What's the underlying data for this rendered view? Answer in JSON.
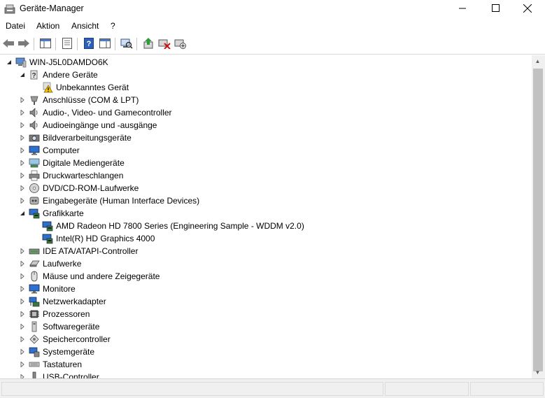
{
  "window": {
    "title": "Geräte-Manager",
    "icon": "device-manager-icon",
    "controls": {
      "minimize": "minimize-icon",
      "maximize": "maximize-icon",
      "close": "close-icon"
    }
  },
  "menu": {
    "items": [
      {
        "label": "Datei"
      },
      {
        "label": "Aktion"
      },
      {
        "label": "Ansicht"
      },
      {
        "label": "?"
      }
    ]
  },
  "toolbar": {
    "buttons": [
      {
        "name": "back-icon"
      },
      {
        "name": "forward-icon"
      },
      {
        "name": "show-hide-console-tree-icon"
      },
      {
        "name": "properties-icon"
      },
      {
        "name": "help-icon"
      },
      {
        "name": "show-action-pane-icon"
      },
      {
        "name": "scan-hardware-changes-icon"
      },
      {
        "name": "update-driver-icon"
      },
      {
        "name": "uninstall-device-icon"
      },
      {
        "name": "disable-device-icon"
      }
    ]
  },
  "tree": {
    "root": {
      "label": "WIN-J5L0DAMDO6K",
      "expanded": true,
      "icon": "computer-icon"
    },
    "categories": [
      {
        "label": "Andere Geräte",
        "expanded": true,
        "icon": "unknown-device-category-icon",
        "children": [
          {
            "label": "Unbekanntes Gerät",
            "icon": "warning-device-icon"
          }
        ]
      },
      {
        "label": "Anschlüsse (COM & LPT)",
        "expanded": false,
        "icon": "port-icon"
      },
      {
        "label": "Audio-, Video- und Gamecontroller",
        "expanded": false,
        "icon": "speaker-icon"
      },
      {
        "label": "Audioeingänge und -ausgänge",
        "expanded": false,
        "icon": "speaker-icon"
      },
      {
        "label": "Bildverarbeitungsgeräte",
        "expanded": false,
        "icon": "camera-icon"
      },
      {
        "label": "Computer",
        "expanded": false,
        "icon": "monitor-icon"
      },
      {
        "label": "Digitale Mediengeräte",
        "expanded": false,
        "icon": "media-device-icon"
      },
      {
        "label": "Druckwarteschlangen",
        "expanded": false,
        "icon": "printer-icon"
      },
      {
        "label": "DVD/CD-ROM-Laufwerke",
        "expanded": false,
        "icon": "disc-drive-icon"
      },
      {
        "label": "Eingabegeräte (Human Interface Devices)",
        "expanded": false,
        "icon": "hid-icon"
      },
      {
        "label": "Grafikkarte",
        "expanded": true,
        "icon": "display-adapter-icon",
        "children": [
          {
            "label": "AMD Radeon HD 7800 Series (Engineering Sample - WDDM v2.0)",
            "icon": "display-adapter-icon"
          },
          {
            "label": "Intel(R) HD Graphics 4000",
            "icon": "display-adapter-icon"
          }
        ]
      },
      {
        "label": "IDE ATA/ATAPI-Controller",
        "expanded": false,
        "icon": "ide-controller-icon"
      },
      {
        "label": "Laufwerke",
        "expanded": false,
        "icon": "disk-drive-icon"
      },
      {
        "label": "Mäuse und andere Zeigegeräte",
        "expanded": false,
        "icon": "mouse-icon"
      },
      {
        "label": "Monitore",
        "expanded": false,
        "icon": "monitor-icon"
      },
      {
        "label": "Netzwerkadapter",
        "expanded": false,
        "icon": "network-adapter-icon"
      },
      {
        "label": "Prozessoren",
        "expanded": false,
        "icon": "processor-icon"
      },
      {
        "label": "Softwaregeräte",
        "expanded": false,
        "icon": "software-device-icon"
      },
      {
        "label": "Speichercontroller",
        "expanded": false,
        "icon": "storage-controller-icon"
      },
      {
        "label": "Systemgeräte",
        "expanded": false,
        "icon": "system-device-icon"
      },
      {
        "label": "Tastaturen",
        "expanded": false,
        "icon": "keyboard-icon"
      },
      {
        "label": "USB-Controller",
        "expanded": false,
        "icon": "usb-icon"
      }
    ]
  },
  "colors": {
    "accent": "#1e4fa8",
    "warning": "#f5c400",
    "scrollbar_thumb": "#c1c1c1"
  }
}
